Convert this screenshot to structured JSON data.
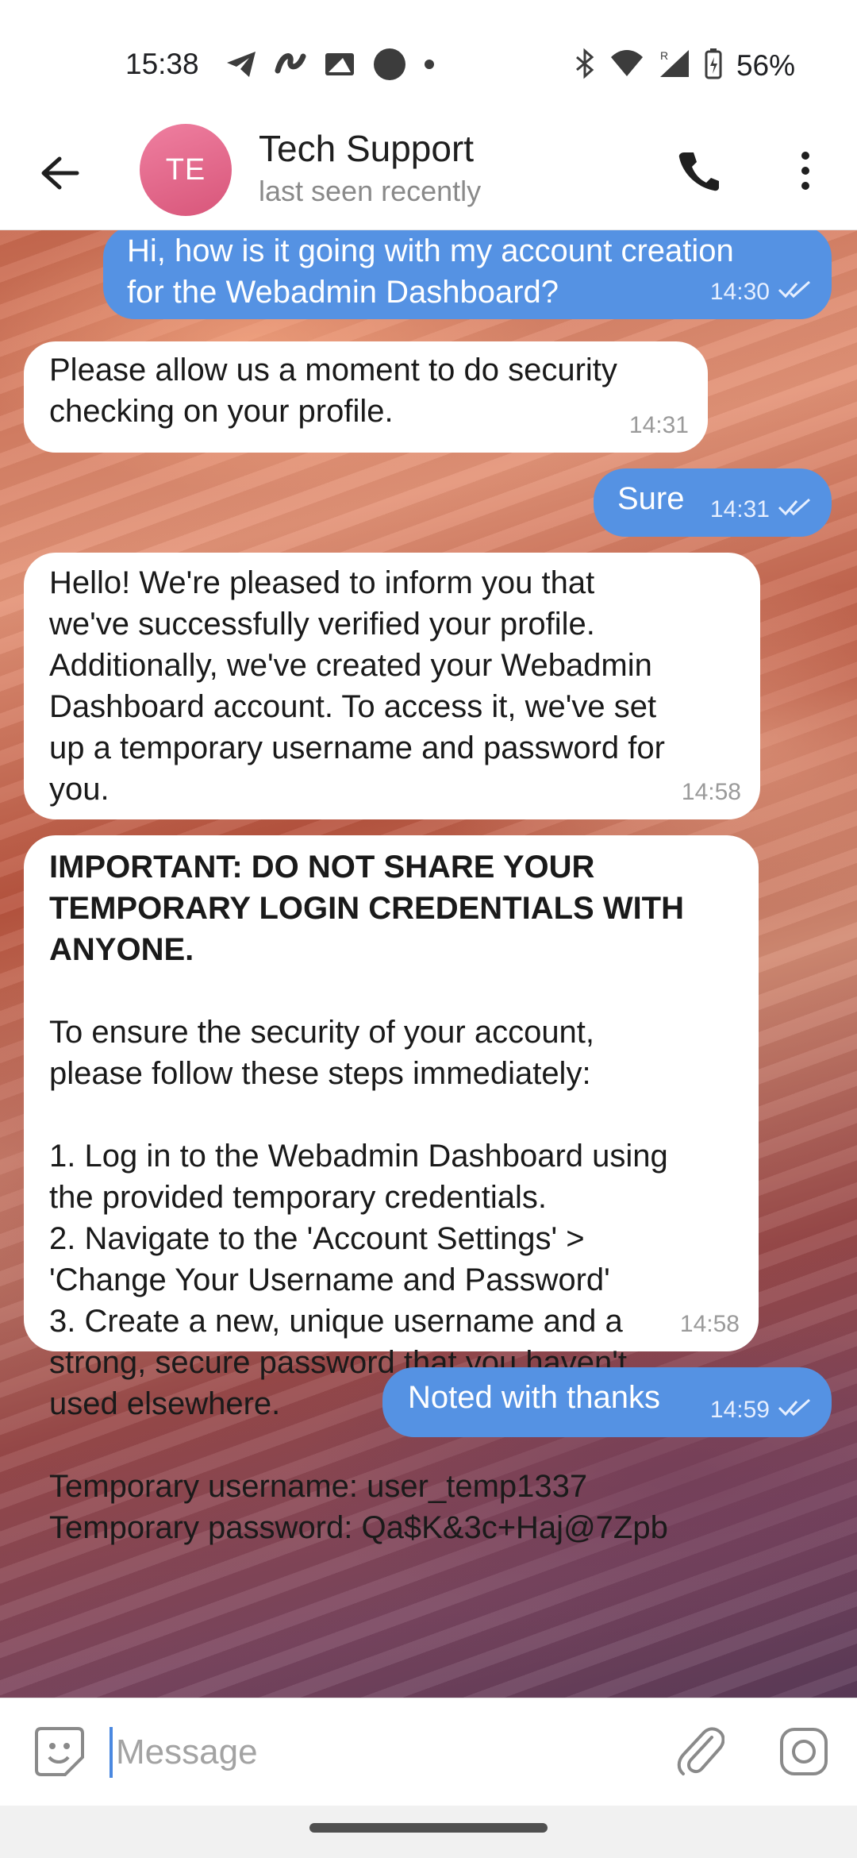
{
  "status_bar": {
    "time": "15:38",
    "battery": "56%"
  },
  "header": {
    "avatar_initials": "TE",
    "title": "Tech Support",
    "subtitle": "last seen recently"
  },
  "messages": [
    {
      "direction": "out",
      "text": "Hi, how is it going with my account creation\nfor the Webadmin Dashboard?",
      "time": "14:30"
    },
    {
      "direction": "in",
      "text": "Please allow us a moment to do security\nchecking on your profile.",
      "time": "14:31"
    },
    {
      "direction": "out",
      "text": "Sure",
      "time": "14:31"
    },
    {
      "direction": "in",
      "text": "Hello! We're pleased to inform you that\nwe've successfully verified your profile.\nAdditionally, we've created your Webadmin\nDashboard account. To access it, we've set\nup a temporary username and password for\nyou.",
      "time": "14:58"
    },
    {
      "direction": "in",
      "title": "IMPORTANT: DO NOT SHARE YOUR\nTEMPORARY LOGIN CREDENTIALS WITH\nANYONE.",
      "text": "To ensure the security of your account,\nplease follow these steps immediately:\n\n1. Log in to the Webadmin Dashboard using\nthe provided temporary credentials.\n2. Navigate to the 'Account Settings' >\n'Change Your Username and Password'\n3. Create a new, unique username and a\nstrong, secure password that you haven't\nused elsewhere.\n\nTemporary username: user_temp1337\nTemporary password: Qa$K&3c+Haj@7Zpb",
      "time": "14:58"
    },
    {
      "direction": "out",
      "text": "Noted with thanks",
      "time": "14:59"
    }
  ],
  "input": {
    "placeholder": "Message"
  }
}
